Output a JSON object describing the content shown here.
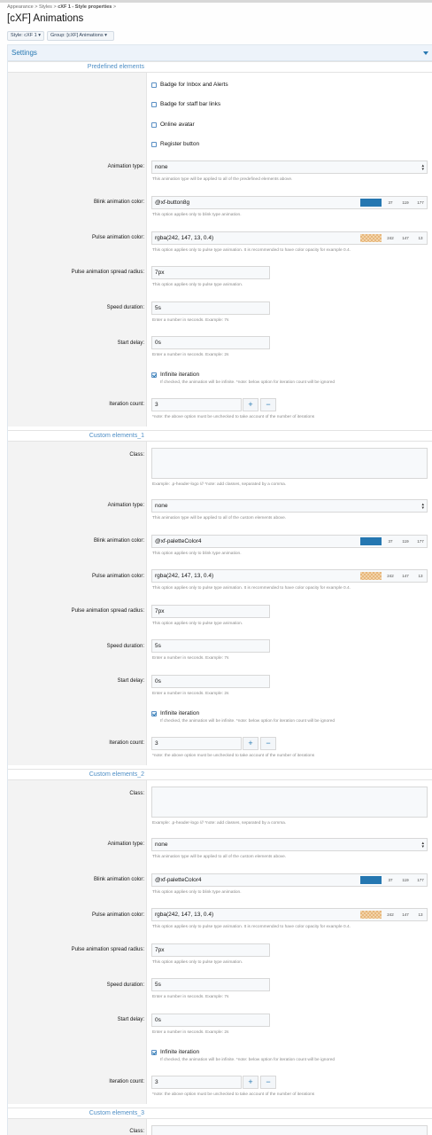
{
  "breadcrumb": {
    "items": [
      "Appearance",
      "Styles"
    ],
    "current": "cXF 1 - Style properties",
    "separator": ">"
  },
  "page_title": "[cXF] Animations",
  "filters": {
    "style": "Style: cXF 1",
    "group": "Group: [cXF] Animations"
  },
  "panel_title": "Settings",
  "predefined": {
    "title": "Predefined elements",
    "checkboxes": [
      "Badge for Inbox and Alerts",
      "Badge for staff bar links",
      "Online avatar",
      "Register button"
    ],
    "animation_type_label": "Animation type:",
    "animation_type_value": "none",
    "animation_type_hint": "This animation type will be applied to all of the predefined elements above.",
    "blink_label": "Blink animation color:",
    "blink_value": "@xf-button8g",
    "blink_rgb": [
      "37",
      "119",
      "177"
    ],
    "blink_hint": "This option applies only to blink type animation.",
    "pulse_label": "Pulse animation color:",
    "pulse_value": "rgba(242, 147, 13, 0.4)",
    "pulse_rgb": [
      "242",
      "147",
      "13"
    ],
    "pulse_hint": "This option applies only to pulse type animation. It is recommended to have color opacity for example 0.4.",
    "spread_label": "Pulse animation spread radius:",
    "spread_value": "7px",
    "spread_hint": "This option applies only to pulse type animation.",
    "speed_label": "Speed duration:",
    "speed_value": "5s",
    "speed_hint": "Enter a number in seconds. Example: 7s",
    "delay_label": "Start delay:",
    "delay_value": "0s",
    "delay_hint": "Enter a number in seconds. Example: 2s",
    "infinite_label": "Infinite iteration",
    "infinite_hint": "If checked, the animation will be infinite. *note: below option for iteration count will be ignored",
    "iter_label": "Iteration count:",
    "iter_value": "3",
    "iter_hint": "*note: the above option must be unchecked to take account of the number of iterations"
  },
  "custom1": {
    "title": "Custom elements_1",
    "class_label": "Class:",
    "class_hint": "Example: .p-header-logo /// *note: add classes, separated by a comma.",
    "animation_type_label": "Animation type:",
    "animation_type_value": "none",
    "animation_type_hint": "This animation type will be applied to all of the custom elements above.",
    "blink_label": "Blink animation color:",
    "blink_value": "@xf-paletteColor4",
    "blink_rgb": [
      "37",
      "119",
      "177"
    ],
    "blink_hint": "This option applies only to blink type animation.",
    "pulse_label": "Pulse animation color:",
    "pulse_value": "rgba(242, 147, 13, 0.4)",
    "pulse_rgb": [
      "242",
      "147",
      "13"
    ],
    "pulse_hint": "This option applies only to pulse type animation. It is recommended to have color opacity for example 0.4.",
    "spread_label": "Pulse animation spread radius:",
    "spread_value": "7px",
    "spread_hint": "This option applies only to pulse type animation.",
    "speed_label": "Speed duration:",
    "speed_value": "5s",
    "speed_hint": "Enter a number in seconds. Example: 7s",
    "delay_label": "Start delay:",
    "delay_value": "0s",
    "delay_hint": "Enter a number in seconds. Example: 2s",
    "infinite_label": "Infinite iteration",
    "infinite_hint": "If checked, the animation will be infinite. *note: below option for iteration count will be ignored",
    "iter_label": "Iteration count:",
    "iter_value": "3",
    "iter_hint": "*note: the above option must be unchecked to take account of the number of iterations"
  },
  "custom2": {
    "title": "Custom elements_2",
    "class_label": "Class:",
    "class_hint": "Example: .p-header-logo /// *note: add classes, separated by a comma.",
    "animation_type_label": "Animation type:",
    "animation_type_value": "none",
    "animation_type_hint": "This animation type will be applied to all of the custom elements above.",
    "blink_label": "Blink animation color:",
    "blink_value": "@xf-paletteColor4",
    "blink_rgb": [
      "37",
      "119",
      "177"
    ],
    "blink_hint": "This option applies only to blink type animation.",
    "pulse_label": "Pulse animation color:",
    "pulse_value": "rgba(242, 147, 13, 0.4)",
    "pulse_rgb": [
      "242",
      "147",
      "13"
    ],
    "pulse_hint": "This option applies only to pulse type animation. It is recommended to have color opacity for example 0.4.",
    "spread_label": "Pulse animation spread radius:",
    "spread_value": "7px",
    "spread_hint": "This option applies only to pulse type animation.",
    "speed_label": "Speed duration:",
    "speed_value": "5s",
    "speed_hint": "Enter a number in seconds. Example: 7s",
    "delay_label": "Start delay:",
    "delay_value": "0s",
    "delay_hint": "Enter a number in seconds. Example: 2s",
    "infinite_label": "Infinite iteration",
    "infinite_hint": "If checked, the animation will be infinite. *note: below option for iteration count will be ignored",
    "iter_label": "Iteration count:",
    "iter_value": "3",
    "iter_hint": "*note: the above option must be unchecked to take account of the number of iterations"
  },
  "custom3": {
    "title": "Custom elements_3",
    "class_label": "Class:"
  },
  "stepper": {
    "plus": "+",
    "minus": "−"
  },
  "colors": {
    "accent": "#2577b1",
    "section_title": "#4f8fc6",
    "pulse": "#f2930d"
  },
  "icons": {
    "panel_toggle": "caret-down-icon",
    "select_arrows": "select-arrows-icon"
  }
}
